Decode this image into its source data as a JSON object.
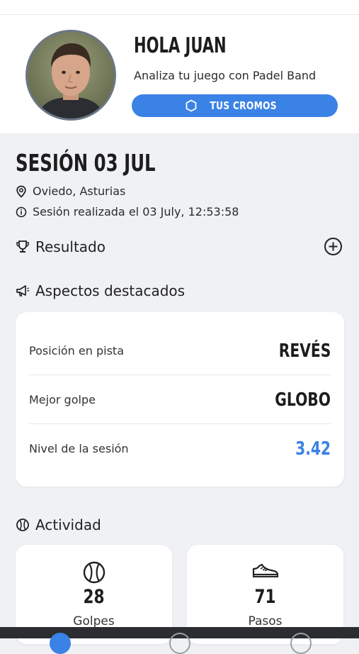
{
  "profile": {
    "greeting": "HOLA JUAN",
    "subtitle": "Analiza tu juego con Padel Band",
    "cromos_label": "TUS CROMOS"
  },
  "session": {
    "title": "SESIÓN 03 JUL",
    "location": "Oviedo, Asturias",
    "performed": "Sesión realizada el 03 July, 12:53:58"
  },
  "sections": {
    "result": "Resultado",
    "highlights": "Aspectos destacados",
    "activity": "Actividad"
  },
  "highlights": [
    {
      "label": "Posición en pista",
      "value": "REVÉS"
    },
    {
      "label": "Mejor golpe",
      "value": "GLOBO"
    },
    {
      "label": "Nivel de la sesión",
      "value": "3.42"
    }
  ],
  "activity": [
    {
      "icon": "tennis-ball-icon",
      "value": "28",
      "label": "Golpes"
    },
    {
      "icon": "sneaker-icon",
      "value": "71",
      "label": "Pasos"
    }
  ],
  "colors": {
    "accent": "#3b82e6",
    "background": "#eff1f4",
    "bottom_nav": "#2b2d31"
  }
}
